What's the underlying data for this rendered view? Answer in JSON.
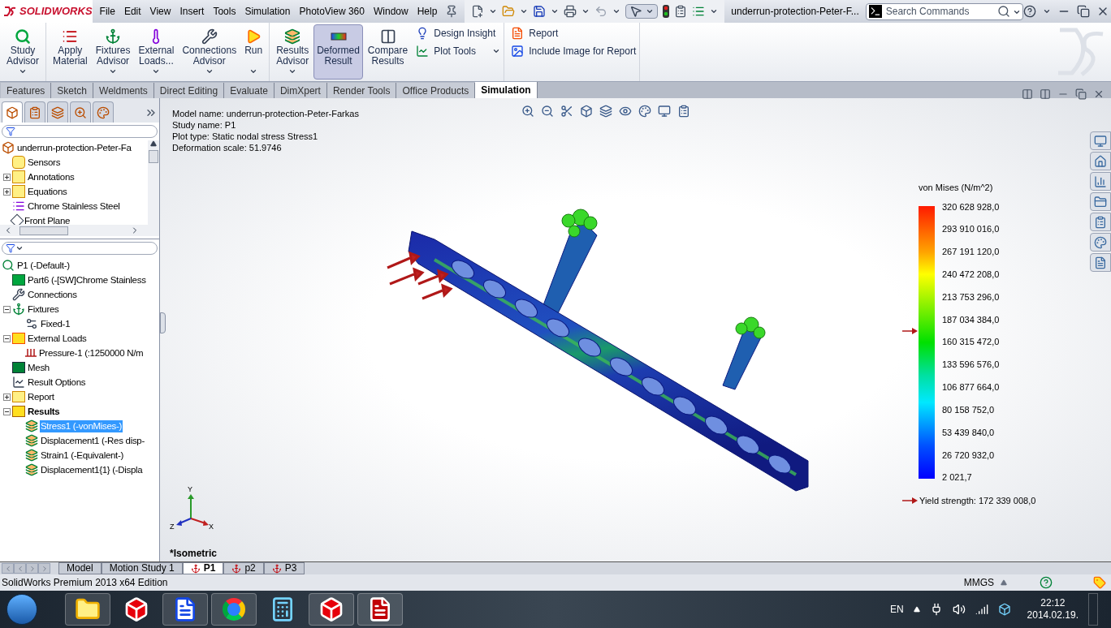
{
  "app": {
    "logo": "SOLIDWORKS"
  },
  "menu": [
    "File",
    "Edit",
    "View",
    "Insert",
    "Tools",
    "Simulation",
    "PhotoView 360",
    "Window",
    "Help"
  ],
  "document_title": "underrun-protection-Peter-F...",
  "search": {
    "placeholder": "Search Commands"
  },
  "ribbon": {
    "groups": [
      {
        "buttons": [
          {
            "label": "Study\nAdvisor",
            "dropdown": true,
            "selected": false
          }
        ]
      },
      {
        "buttons": [
          {
            "label": "Apply\nMaterial",
            "dropdown": false,
            "selected": false
          },
          {
            "label": "Fixtures\nAdvisor",
            "dropdown": true,
            "selected": false
          },
          {
            "label": "External\nLoads...",
            "dropdown": true,
            "selected": false
          },
          {
            "label": "Connections\nAdvisor",
            "dropdown": true,
            "selected": false
          },
          {
            "label": "Run",
            "dropdown": true,
            "selected": false
          }
        ]
      },
      {
        "buttons": [
          {
            "label": "Results\nAdvisor",
            "dropdown": true,
            "selected": false
          },
          {
            "label": "Deformed\nResult",
            "dropdown": false,
            "selected": true
          },
          {
            "label": "Compare\nResults",
            "dropdown": false,
            "selected": false
          }
        ],
        "small": [
          {
            "label": "Design Insight",
            "dropdown": false
          },
          {
            "label": "Plot Tools",
            "dropdown": true
          }
        ]
      },
      {
        "small": [
          {
            "label": "Report",
            "dropdown": false
          },
          {
            "label": "Include Image for Report",
            "dropdown": false
          }
        ]
      }
    ]
  },
  "tabs": [
    {
      "label": "Features",
      "selected": false
    },
    {
      "label": "Sketch",
      "selected": false
    },
    {
      "label": "Weldments",
      "selected": false
    },
    {
      "label": "Direct Editing",
      "selected": false
    },
    {
      "label": "Evaluate",
      "selected": false
    },
    {
      "label": "DimXpert",
      "selected": false
    },
    {
      "label": "Render Tools",
      "selected": false
    },
    {
      "label": "Office Products",
      "selected": false
    },
    {
      "label": "Simulation",
      "selected": true
    }
  ],
  "manager_tabs": [
    {
      "selected": true
    },
    {
      "selected": false
    },
    {
      "selected": false
    },
    {
      "selected": false
    },
    {
      "selected": false
    }
  ],
  "feature_tree": [
    {
      "label": "underrun-protection-Peter-Fa",
      "kind": "part",
      "children": [
        {
          "label": "Sensors",
          "kind": "sensors"
        },
        {
          "label": "Annotations",
          "kind": "annotations",
          "expanded": false
        },
        {
          "label": "Equations",
          "kind": "equations",
          "expanded": false
        },
        {
          "label": "Chrome Stainless Steel",
          "kind": "material"
        },
        {
          "label": "Front Plane",
          "kind": "plane"
        }
      ]
    }
  ],
  "study_tree": [
    {
      "label": "P1 (-Default-)",
      "kind": "study",
      "selected": false,
      "children": [
        {
          "label": "Part6 (-[SW]Chrome Stainless",
          "kind": "solid",
          "selected": false
        },
        {
          "label": "Connections",
          "kind": "connections",
          "selected": false
        },
        {
          "label": "Fixtures",
          "kind": "fixtures",
          "selected": false,
          "expanded": true,
          "children": [
            {
              "label": "Fixed-1",
              "kind": "fixed",
              "selected": false
            }
          ]
        },
        {
          "label": "External Loads",
          "kind": "loads",
          "selected": false,
          "expanded": true,
          "children": [
            {
              "label": "Pressure-1 (:1250000 N/m",
              "kind": "pressure",
              "selected": false
            }
          ]
        },
        {
          "label": "Mesh",
          "kind": "mesh",
          "selected": false
        },
        {
          "label": "Result Options",
          "kind": "options",
          "selected": false
        },
        {
          "label": "Report",
          "kind": "report",
          "selected": false,
          "expanded": false
        },
        {
          "label": "Results",
          "kind": "results",
          "selected": false,
          "bold": true,
          "expanded": true,
          "children": [
            {
              "label": "Stress1 (-vonMises-)",
              "kind": "plot",
              "selected": true
            },
            {
              "label": "Displacement1 (-Res disp-",
              "kind": "plot",
              "selected": false
            },
            {
              "label": "Strain1 (-Equivalent-)",
              "kind": "plot",
              "selected": false
            },
            {
              "label": "Displacement1{1} (-Displa",
              "kind": "plot",
              "selected": false
            }
          ]
        }
      ]
    }
  ],
  "plot_info": [
    "Model name: underrun-protection-Peter-Farkas",
    "Study name: P1",
    "Plot type: Static nodal stress Stress1",
    "Deformation scale: 51.9746"
  ],
  "legend": {
    "title": "von Mises (N/m^2)",
    "labels": [
      "320 628 928,0",
      "293 910 016,0",
      "267 191 120,0",
      "240 472 208,0",
      "213 753 296,0",
      "187 034 384,0",
      "160 315 472,0",
      "133 596 576,0",
      "106 877 664,0",
      "80 158 752,0",
      "53 439 840,0",
      "26 720 932,0",
      "2 021,7"
    ],
    "yield": "Yield strength: 172 339 008,0"
  },
  "triad": {
    "y": "Y",
    "x": "X",
    "z": "Z"
  },
  "view_name": "*Isometric",
  "bottom_tabs": [
    {
      "label": "Model",
      "kind": "model",
      "selected": false
    },
    {
      "label": "Motion Study 1",
      "kind": "model",
      "selected": false
    },
    {
      "label": "P1",
      "kind": "study",
      "selected": true
    },
    {
      "label": "p2",
      "kind": "study",
      "selected": false
    },
    {
      "label": "P3",
      "kind": "study",
      "selected": false
    }
  ],
  "status_bar": {
    "text": "SolidWorks Premium 2013 x64 Edition",
    "units": "MMGS"
  },
  "taskbar": {
    "language": "EN",
    "time": "22:12",
    "date": "2014.02.19."
  }
}
